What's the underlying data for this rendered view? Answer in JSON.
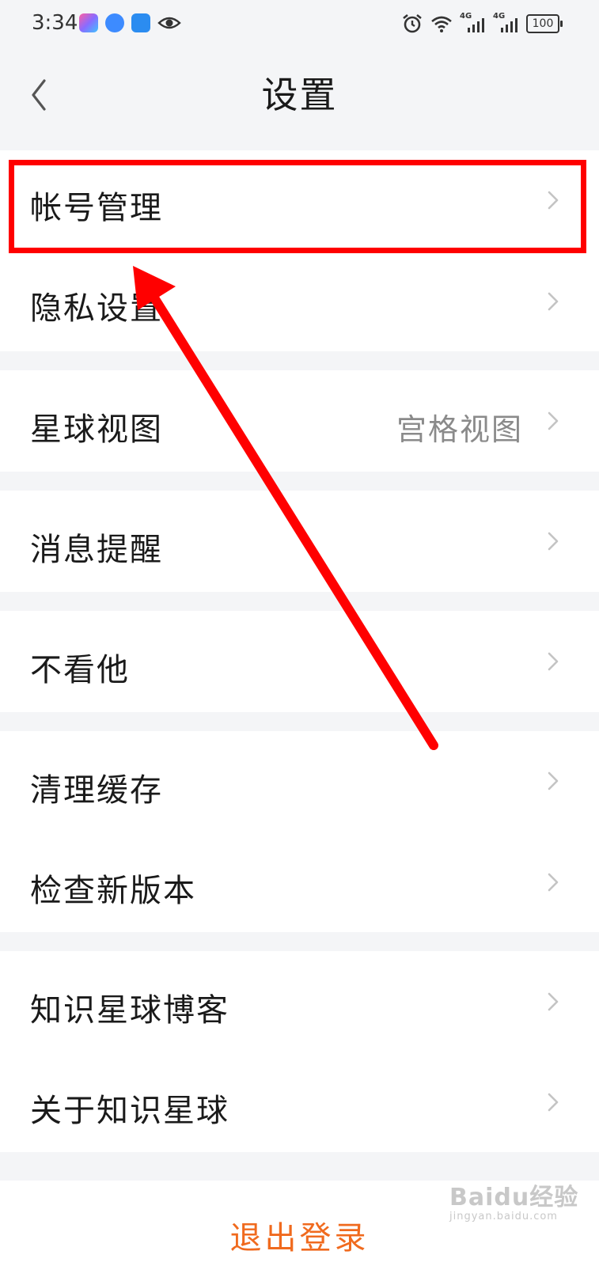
{
  "status_bar": {
    "time": "3:34",
    "network_tag_1": "4G",
    "network_tag_2": "4G",
    "battery": "100"
  },
  "nav": {
    "title": "设置"
  },
  "rows": {
    "account": {
      "label": "帐号管理"
    },
    "privacy": {
      "label": "隐私设置"
    },
    "planet_view": {
      "label": "星球视图",
      "value": "宫格视图"
    },
    "notifications": {
      "label": "消息提醒"
    },
    "hide": {
      "label": "不看他"
    },
    "clear_cache": {
      "label": "清理缓存"
    },
    "check_update": {
      "label": "检查新版本"
    },
    "blog": {
      "label": "知识星球博客"
    },
    "about": {
      "label": "关于知识星球"
    }
  },
  "logout": {
    "label": "退出登录"
  },
  "watermark": {
    "logo": "Baidu经验",
    "sub": "jingyan.baidu.com"
  },
  "colors": {
    "background": "#f4f5f7",
    "card": "#ffffff",
    "text": "#1a1a1a",
    "secondary_text": "#8a8a8a",
    "chevron": "#c4c4c4",
    "logout": "#f06a1e",
    "annotation": "#ff0000"
  }
}
